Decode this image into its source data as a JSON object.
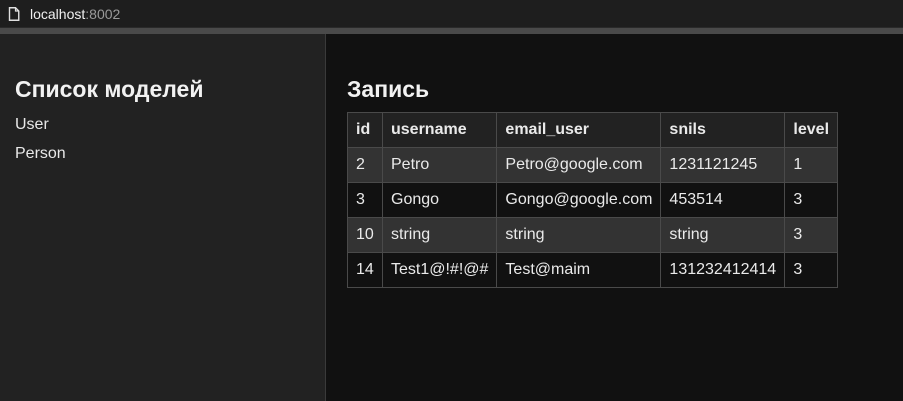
{
  "browser": {
    "url_host": "localhost",
    "url_port": ":8002",
    "page_icon": "document-icon"
  },
  "sidebar": {
    "title": "Список моделей",
    "items": [
      {
        "label": "User"
      },
      {
        "label": "Person"
      }
    ]
  },
  "main": {
    "title": "Запись",
    "table": {
      "headers": [
        "id",
        "username",
        "email_user",
        "snils",
        "level"
      ],
      "rows": [
        [
          "2",
          "Petro",
          "Petro@google.com",
          "1231121245",
          "1"
        ],
        [
          "3",
          "Gongo",
          "Gongo@google.com",
          "453514",
          "3"
        ],
        [
          "10",
          "string",
          "string",
          "string",
          "3"
        ],
        [
          "14",
          "Test1@!#!@#",
          "Test@maim",
          "131232412414",
          "3"
        ]
      ]
    }
  }
}
